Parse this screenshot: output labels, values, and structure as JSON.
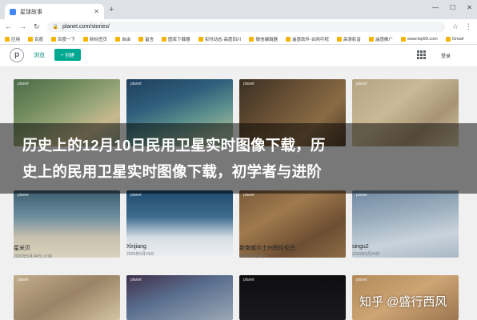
{
  "browser": {
    "tab_title": "星球故事",
    "url": "planet.com/stories/",
    "bookmarks": [
      "应用",
      "百度",
      "百度一下",
      "新标签页",
      "自由",
      "留言",
      "图库下载器",
      "实时动态·高度四川",
      "微信编辑器",
      "遥感软件·合网可视",
      "高清影音",
      "遥感推广",
      "www.liqi99.com",
      "Gmail"
    ]
  },
  "app": {
    "logo_letter": "p",
    "nav_browse": "浏览",
    "new_button": "+ 创建",
    "login": "登录"
  },
  "gallery": {
    "cards": [
      {
        "name": "",
        "date": ""
      },
      {
        "name": "",
        "date": ""
      },
      {
        "name": "",
        "date": ""
      },
      {
        "name": "",
        "date": ""
      },
      {
        "name": "星米贝",
        "date": "2020年5月24日 | 0:06"
      },
      {
        "name": "Xinjiang",
        "date": "2020年5月24日"
      },
      {
        "name": "新南威尔士州图伦伦巴",
        "date": "2020年5月24日"
      },
      {
        "name": "singu2",
        "date": "2020年5月24日"
      }
    ],
    "placemark": "planet"
  },
  "banner": {
    "line1": "历史上的12月10日民用卫星实时图像下载，历",
    "line2": "史上的民用卫星实时图像下载，初学者与进阶"
  },
  "watermark": {
    "text": "知乎 @盛行西风"
  }
}
